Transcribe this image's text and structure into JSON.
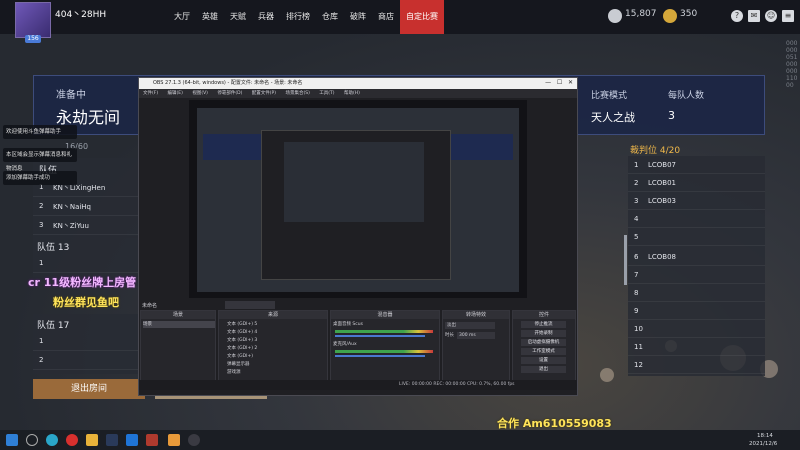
{
  "topbar": {
    "level": "156",
    "username": "404丶28HH",
    "nav": [
      "大厅",
      "英雄",
      "天赋",
      "兵器",
      "排行榜",
      "仓库",
      "破阵",
      "商店",
      "自定比赛"
    ],
    "active_nav": "自定比赛",
    "currency1": "15,807",
    "currency2": "350"
  },
  "side_vertical_text": "00000005100000011000",
  "lobby": {
    "status_label": "准备中",
    "mode_name": "永劫无间",
    "match_mode_label": "比赛模式",
    "match_mode_value": "天人之战",
    "team_size_label": "每队人数",
    "team_size_value": "3",
    "team_count": "16/60",
    "spectator_title": "裁判位 4/20"
  },
  "teams": [
    {
      "label": "队伍",
      "members": [
        {
          "n": "1",
          "name": "KN丶LiXingHen"
        },
        {
          "n": "2",
          "name": "KN丶NaiHq"
        },
        {
          "n": "3",
          "name": "KN丶ZiYuu"
        }
      ]
    },
    {
      "label": "队伍 13",
      "members": [
        {
          "n": "1",
          "name": ""
        },
        {
          "n": "2",
          "name": ""
        }
      ]
    },
    {
      "label": "队伍 17",
      "members": [
        {
          "n": "1",
          "name": ""
        },
        {
          "n": "2",
          "name": ""
        }
      ]
    }
  ],
  "spectators": [
    {
      "n": "1",
      "name": "LCOB07"
    },
    {
      "n": "2",
      "name": "LCOB01"
    },
    {
      "n": "3",
      "name": "LCOB03"
    },
    {
      "n": "4",
      "name": ""
    },
    {
      "n": "5",
      "name": ""
    },
    {
      "n": "6",
      "name": "LCOB08"
    },
    {
      "n": "7",
      "name": ""
    },
    {
      "n": "8",
      "name": ""
    },
    {
      "n": "9",
      "name": ""
    },
    {
      "n": "10",
      "name": ""
    },
    {
      "n": "11",
      "name": ""
    },
    {
      "n": "12",
      "name": ""
    }
  ],
  "chat": [
    "欢迎使用斗鱼弹幕助手",
    "本区域会显示弹幕消息和礼物消息",
    "添加弹幕助手成功"
  ],
  "promo": {
    "line1": "cr 11级粉丝牌上房管",
    "line2": "粉丝群见鱼吧",
    "contact": "合作 Am610559083"
  },
  "buttons": {
    "exit_room": "退出房间"
  },
  "obs": {
    "title": "OBS 27.1.3 (64-bit, windows) - 配置文件: 未命名 - 场景: 未命名",
    "menu": [
      "文件(F)",
      "编辑(E)",
      "视图(V)",
      "停靠部件(D)",
      "配置文件(P)",
      "场景集合(S)",
      "工具(T)",
      "帮助(H)"
    ],
    "source_name": "未命名",
    "scenes_header": "场景",
    "scene_item": "场景",
    "sources_header": "来源",
    "sources": [
      "文本 (GDI+) 5",
      "文本 (GDI+) 4",
      "文本 (GDI+) 3",
      "文本 (GDI+) 2",
      "文本 (GDI+)",
      "弹幕显示器",
      "游戏源"
    ],
    "mixer_header": "混音器",
    "mixer_track1": "桌面音频 Scus",
    "mixer_track2": "麦克风/Aux",
    "transitions_header": "转场特效",
    "transition_value": "淡出",
    "duration_label": "时长",
    "duration_value": "300 ms",
    "controls_header": "控件",
    "controls": [
      "停止推流",
      "开始录制",
      "启动虚拟摄像机",
      "工作室模式",
      "设置",
      "退出"
    ],
    "status": "LIVE: 00:00:00  REC: 00:00:00  CPU: 0.7%, 60.00 fps"
  },
  "taskbar": {
    "time": "18:14",
    "date": "2021/12/6"
  }
}
